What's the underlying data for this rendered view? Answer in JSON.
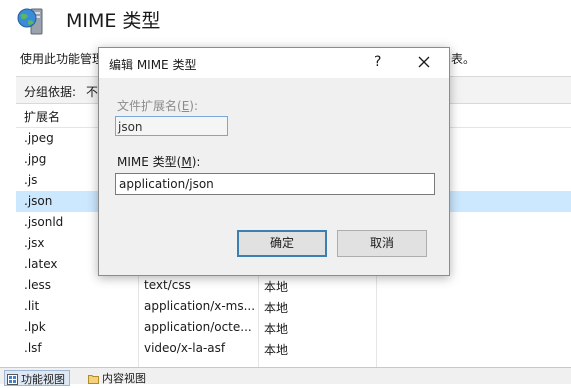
{
  "header": {
    "title": "MIME 类型",
    "description_left": "使用此功能管理",
    "description_right": "表。"
  },
  "group_bar": {
    "label": "分组依据:",
    "value": "不"
  },
  "list": {
    "columns": [
      "扩展名"
    ],
    "rows": [
      {
        "ext": ".jpeg",
        "type": "",
        "entry": "",
        "selected": false
      },
      {
        "ext": ".jpg",
        "type": "",
        "entry": "",
        "selected": false
      },
      {
        "ext": ".js",
        "type": "",
        "entry": "",
        "selected": false
      },
      {
        "ext": ".json",
        "type": "",
        "entry": "",
        "selected": true
      },
      {
        "ext": ".jsonld",
        "type": "",
        "entry": "",
        "selected": false
      },
      {
        "ext": ".jsx",
        "type": "",
        "entry": "",
        "selected": false
      },
      {
        "ext": ".latex",
        "type": "",
        "entry": "",
        "selected": false
      },
      {
        "ext": ".less",
        "type": "text/css",
        "entry": "本地",
        "selected": false
      },
      {
        "ext": ".lit",
        "type": "application/x-ms...",
        "entry": "本地",
        "selected": false
      },
      {
        "ext": ".lpk",
        "type": "application/octe...",
        "entry": "本地",
        "selected": false
      },
      {
        "ext": ".lsf",
        "type": "video/x-la-asf",
        "entry": "本地",
        "selected": false
      }
    ]
  },
  "bottom_tabs": {
    "feature_view": "功能视图",
    "content_view": "内容视图"
  },
  "dialog": {
    "title": "编辑 MIME 类型",
    "help": "?",
    "ext_label_prefix": "文件扩展名(",
    "ext_label_key": "E",
    "ext_label_suffix": "):",
    "ext_value": "json",
    "mime_label_prefix": "MIME 类型(",
    "mime_label_key": "M",
    "mime_label_suffix": "):",
    "mime_value": "application/json",
    "ok": "确定",
    "cancel": "取消"
  },
  "colors": {
    "selection": "#cce8ff",
    "accent": "#3c7fb1"
  },
  "icons": [
    "server-globe-icon",
    "close-icon",
    "feature-view-icon",
    "content-view-icon"
  ]
}
